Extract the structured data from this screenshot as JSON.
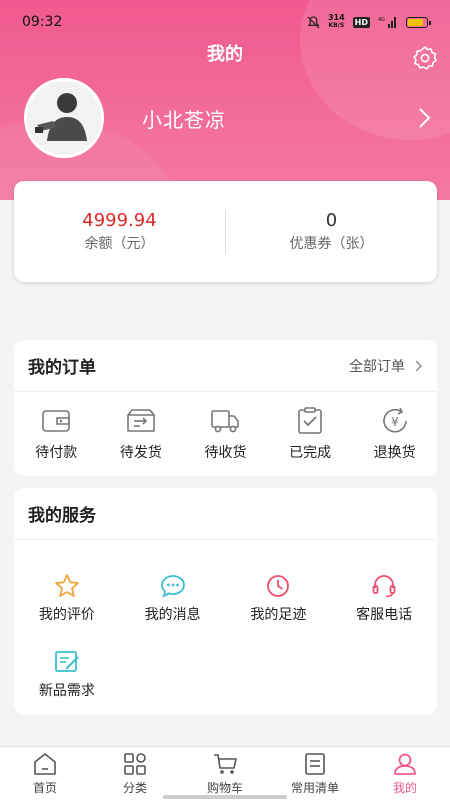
{
  "status_bar": {
    "time": "09:32",
    "net_speed_top": "314",
    "net_speed_bottom": "KB/S",
    "hd": "HD",
    "signal": "4G"
  },
  "header": {
    "title": "我的"
  },
  "profile": {
    "username": "小北苍凉"
  },
  "wallet": {
    "balance_value": "4999.94",
    "balance_label": "余额（元）",
    "coupons_value": "0",
    "coupons_label": "优惠券（张）"
  },
  "orders": {
    "title": "我的订单",
    "all_label": "全部订单",
    "items": [
      {
        "label": "待付款",
        "icon": "wallet-icon"
      },
      {
        "label": "待发货",
        "icon": "ship-box-icon"
      },
      {
        "label": "待收货",
        "icon": "truck-icon"
      },
      {
        "label": "已完成",
        "icon": "clipboard-check-icon"
      },
      {
        "label": "退换货",
        "icon": "yen-return-icon"
      }
    ]
  },
  "services": {
    "title": "我的服务",
    "items": [
      {
        "label": "我的评价",
        "icon": "star-icon",
        "color": "#f2a33a"
      },
      {
        "label": "我的消息",
        "icon": "chat-icon",
        "color": "#3bbfcf"
      },
      {
        "label": "我的足迹",
        "icon": "clock-icon",
        "color": "#e8506b"
      },
      {
        "label": "客服电话",
        "icon": "headset-icon",
        "color": "#e8506b"
      },
      {
        "label": "新品需求",
        "icon": "edit-note-icon",
        "color": "#3bbfcf"
      }
    ]
  },
  "tabbar": {
    "items": [
      {
        "label": "首页",
        "icon": "home-icon"
      },
      {
        "label": "分类",
        "icon": "category-icon"
      },
      {
        "label": "购物车",
        "icon": "cart-icon"
      },
      {
        "label": "常用清单",
        "icon": "list-icon"
      },
      {
        "label": "我的",
        "icon": "user-icon",
        "active": true
      }
    ]
  },
  "colors": {
    "brand_pink": "#f0598f",
    "price_red": "#e02a2a"
  }
}
